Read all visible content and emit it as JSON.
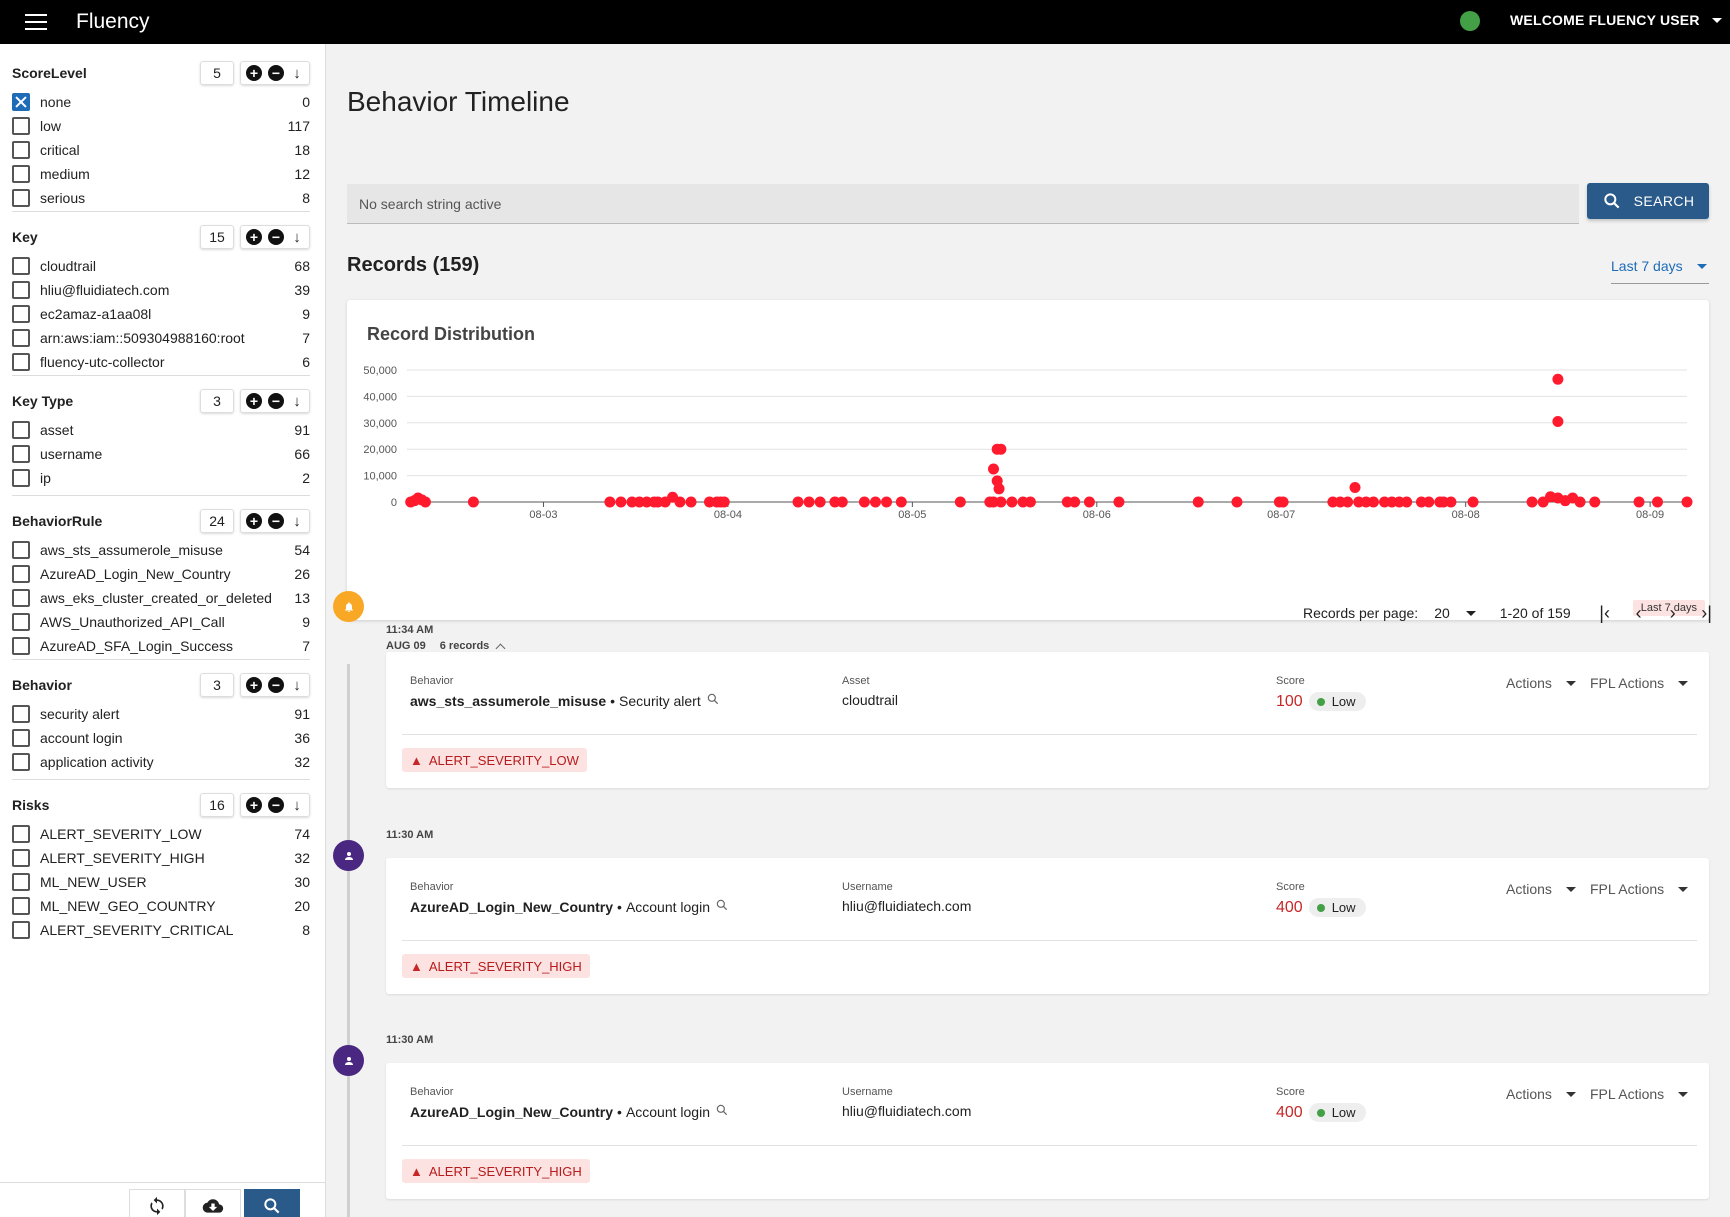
{
  "app": {
    "title": "Fluency",
    "welcome": "WELCOME FLUENCY USER",
    "status_color": "#43a047"
  },
  "sidebar": {
    "facets": [
      {
        "title": "ScoreLevel",
        "count": "5",
        "items": [
          {
            "label": "none",
            "count": "0",
            "checked": true
          },
          {
            "label": "low",
            "count": "117"
          },
          {
            "label": "critical",
            "count": "18"
          },
          {
            "label": "medium",
            "count": "12"
          },
          {
            "label": "serious",
            "count": "8"
          }
        ]
      },
      {
        "title": "Key",
        "count": "15",
        "items": [
          {
            "label": "cloudtrail",
            "count": "68"
          },
          {
            "label": "hliu@fluidiatech.com",
            "count": "39"
          },
          {
            "label": "ec2amaz-a1aa08l",
            "count": "9"
          },
          {
            "label": "arn:aws:iam::509304988160:root",
            "count": "7"
          },
          {
            "label": "fluency-utc-collector",
            "count": "6"
          }
        ]
      },
      {
        "title": "Key Type",
        "count": "3",
        "items": [
          {
            "label": "asset",
            "count": "91"
          },
          {
            "label": "username",
            "count": "66"
          },
          {
            "label": "ip",
            "count": "2"
          }
        ]
      },
      {
        "title": "BehaviorRule",
        "count": "24",
        "items": [
          {
            "label": "aws_sts_assumerole_misuse",
            "count": "54"
          },
          {
            "label": "AzureAD_Login_New_Country",
            "count": "26"
          },
          {
            "label": "aws_eks_cluster_created_or_deleted",
            "count": "13"
          },
          {
            "label": "AWS_Unauthorized_API_Call",
            "count": "9"
          },
          {
            "label": "AzureAD_SFA_Login_Success",
            "count": "7"
          }
        ]
      },
      {
        "title": "Behavior",
        "count": "3",
        "items": [
          {
            "label": "security alert",
            "count": "91"
          },
          {
            "label": "account login",
            "count": "36"
          },
          {
            "label": "application activity",
            "count": "32"
          }
        ]
      },
      {
        "title": "Risks",
        "count": "16",
        "items": [
          {
            "label": "ALERT_SEVERITY_LOW",
            "count": "74"
          },
          {
            "label": "ALERT_SEVERITY_HIGH",
            "count": "32"
          },
          {
            "label": "ML_NEW_USER",
            "count": "30"
          },
          {
            "label": "ML_NEW_GEO_COUNTRY",
            "count": "20"
          },
          {
            "label": "ALERT_SEVERITY_CRITICAL",
            "count": "8"
          }
        ]
      }
    ],
    "bottom_buttons": [
      "refresh-icon",
      "cloud-download-icon",
      "search-icon"
    ]
  },
  "main": {
    "page_title": "Behavior Timeline",
    "search": {
      "placeholder": "No search string active",
      "button_label": "SEARCH"
    },
    "records_title": "Records (159)",
    "range_label": "Last 7 days",
    "chart_badge": "Last 7 days",
    "pager": {
      "per_page_label": "Records per page:",
      "per_page": "20",
      "range": "1-20 of 159"
    },
    "timeline": {
      "day": "AUG 09",
      "day_records": "6 records",
      "entries": [
        {
          "time": "11:34 AM",
          "icon": "bell-icon",
          "dot_color": "#f9a825",
          "behavior_label": "Behavior",
          "rule": "aws_sts_assumerole_misuse",
          "behavior": "Security alert",
          "key_label": "Asset",
          "key_value": "cloudtrail",
          "score_label": "Score",
          "score": "100",
          "level": "Low",
          "actions": "Actions",
          "fpl_actions": "FPL Actions",
          "risk": "ALERT_SEVERITY_LOW"
        },
        {
          "time": "11:30 AM",
          "icon": "person-icon",
          "dot_color": "#4a2780",
          "behavior_label": "Behavior",
          "rule": "AzureAD_Login_New_Country",
          "behavior": "Account login",
          "key_label": "Username",
          "key_value": "hliu@fluidiatech.com",
          "score_label": "Score",
          "score": "400",
          "level": "Low",
          "actions": "Actions",
          "fpl_actions": "FPL Actions",
          "risk": "ALERT_SEVERITY_HIGH"
        },
        {
          "time": "11:30 AM",
          "icon": "person-icon",
          "dot_color": "#4a2780",
          "behavior_label": "Behavior",
          "rule": "AzureAD_Login_New_Country",
          "behavior": "Account login",
          "key_label": "Username",
          "key_value": "hliu@fluidiatech.com",
          "score_label": "Score",
          "score": "400",
          "level": "Low",
          "actions": "Actions",
          "fpl_actions": "FPL Actions",
          "risk": "ALERT_SEVERITY_HIGH"
        }
      ]
    }
  },
  "chart_data": {
    "type": "scatter",
    "title": "Record Distribution",
    "color": "#ff1a2e",
    "ylim": [
      0,
      50000
    ],
    "yticks": [
      "0",
      "10,000",
      "20,000",
      "30,000",
      "40,000",
      "50,000"
    ],
    "ytick_values": [
      0,
      10000,
      20000,
      30000,
      40000,
      50000
    ],
    "xticks": [
      "08-03",
      "08-04",
      "08-05",
      "08-06",
      "08-07",
      "08-08",
      "08-09"
    ],
    "xtick_values": [
      1,
      2,
      3,
      4,
      5,
      6,
      7
    ],
    "xlim": [
      0.26,
      7.2
    ],
    "grid": true,
    "points": [
      [
        0.28,
        0
      ],
      [
        0.3,
        500
      ],
      [
        0.32,
        1500
      ],
      [
        0.34,
        800
      ],
      [
        0.36,
        0
      ],
      [
        0.62,
        0
      ],
      [
        1.36,
        0
      ],
      [
        1.42,
        0
      ],
      [
        1.48,
        0
      ],
      [
        1.52,
        0
      ],
      [
        1.56,
        0
      ],
      [
        1.6,
        0
      ],
      [
        1.62,
        0
      ],
      [
        1.66,
        0
      ],
      [
        1.7,
        1800
      ],
      [
        1.74,
        0
      ],
      [
        1.8,
        0
      ],
      [
        1.9,
        0
      ],
      [
        1.94,
        0
      ],
      [
        1.96,
        0
      ],
      [
        1.98,
        0
      ],
      [
        2.38,
        0
      ],
      [
        2.44,
        0
      ],
      [
        2.5,
        0
      ],
      [
        2.58,
        0
      ],
      [
        2.62,
        0
      ],
      [
        2.74,
        0
      ],
      [
        2.8,
        0
      ],
      [
        2.86,
        0
      ],
      [
        2.94,
        0
      ],
      [
        3.26,
        0
      ],
      [
        3.42,
        0
      ],
      [
        3.44,
        0
      ],
      [
        3.46,
        20000
      ],
      [
        3.48,
        20000
      ],
      [
        3.44,
        12500
      ],
      [
        3.46,
        8000
      ],
      [
        3.47,
        5000
      ],
      [
        3.48,
        0
      ],
      [
        3.54,
        0
      ],
      [
        3.6,
        0
      ],
      [
        3.64,
        0
      ],
      [
        3.84,
        0
      ],
      [
        3.88,
        0
      ],
      [
        3.96,
        0
      ],
      [
        4.12,
        0
      ],
      [
        4.55,
        0
      ],
      [
        4.76,
        0
      ],
      [
        4.99,
        0
      ],
      [
        5.01,
        0
      ],
      [
        5.28,
        0
      ],
      [
        5.32,
        0
      ],
      [
        5.36,
        0
      ],
      [
        5.4,
        5500
      ],
      [
        5.42,
        0
      ],
      [
        5.46,
        0
      ],
      [
        5.5,
        0
      ],
      [
        5.56,
        0
      ],
      [
        5.6,
        0
      ],
      [
        5.64,
        0
      ],
      [
        5.68,
        0
      ],
      [
        5.76,
        0
      ],
      [
        5.8,
        0
      ],
      [
        5.86,
        0
      ],
      [
        5.88,
        0
      ],
      [
        5.92,
        0
      ],
      [
        6.04,
        0
      ],
      [
        6.36,
        0
      ],
      [
        6.42,
        0
      ],
      [
        6.46,
        2000
      ],
      [
        6.5,
        1500
      ],
      [
        6.54,
        500
      ],
      [
        6.58,
        1500
      ],
      [
        6.62,
        0
      ],
      [
        6.7,
        0
      ],
      [
        6.5,
        30500
      ],
      [
        6.5,
        46500
      ],
      [
        6.94,
        0
      ],
      [
        7.04,
        0
      ],
      [
        7.4,
        0
      ]
    ]
  }
}
